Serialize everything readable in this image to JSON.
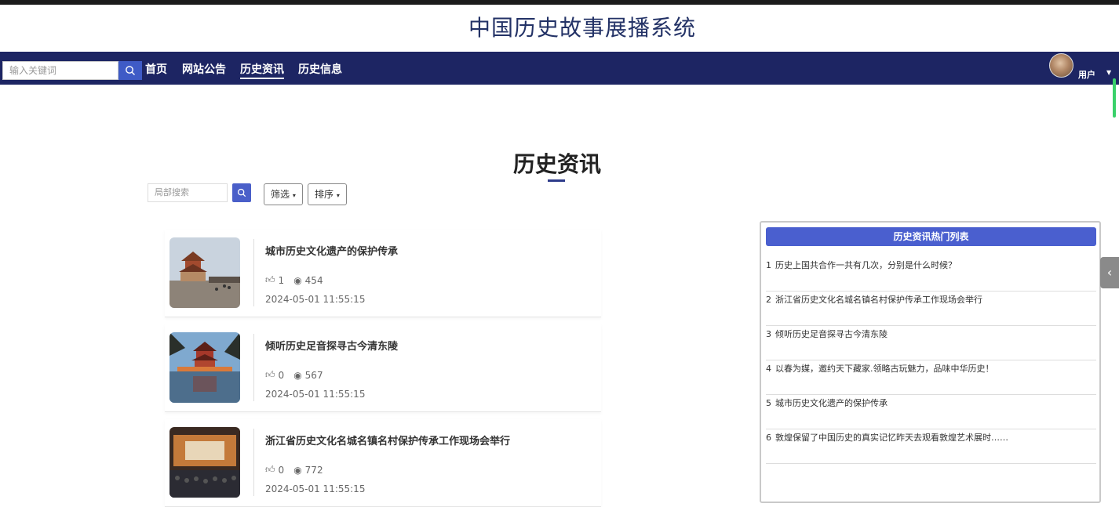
{
  "site": {
    "title": "中国历史故事展播系统"
  },
  "nav": {
    "search_placeholder": "输入关键词",
    "items": [
      {
        "label": "首页"
      },
      {
        "label": "网站公告"
      },
      {
        "label": "历史资讯",
        "active": true
      },
      {
        "label": "历史信息"
      }
    ],
    "user_label": "用户"
  },
  "page": {
    "heading": "历史资讯",
    "local_search_placeholder": "局部搜索",
    "filter_label": "筛选",
    "sort_label": "排序"
  },
  "articles": [
    {
      "title": "城市历史文化遗产的保护传承",
      "likes": "1",
      "views": "454",
      "date": "2024-05-01 11:55:15"
    },
    {
      "title": "倾听历史足音探寻古今清东陵",
      "likes": "0",
      "views": "567",
      "date": "2024-05-01 11:55:15"
    },
    {
      "title": "浙江省历史文化名城名镇名村保护传承工作现场会举行",
      "likes": "0",
      "views": "772",
      "date": "2024-05-01 11:55:15"
    }
  ],
  "hot": {
    "header": "历史资讯热门列表",
    "items": [
      {
        "num": "1",
        "text": "历史上国共合作一共有几次，分别是什么时候？"
      },
      {
        "num": "2",
        "text": "浙江省历史文化名城名镇名村保护传承工作现场会举行"
      },
      {
        "num": "3",
        "text": "倾听历史足音探寻古今清东陵"
      },
      {
        "num": "4",
        "text": "以春为媒，邀约天下藏家.领略古玩魅力，品味中华历史！"
      },
      {
        "num": "5",
        "text": "城市历史文化遗产的保护传承"
      },
      {
        "num": "6",
        "text": "敦煌保留了中国历史的真实记忆昨天去观看敦煌艺术展时……"
      }
    ]
  },
  "colors": {
    "nav_bg": "#1d2563",
    "accent": "#4a5fcf"
  }
}
